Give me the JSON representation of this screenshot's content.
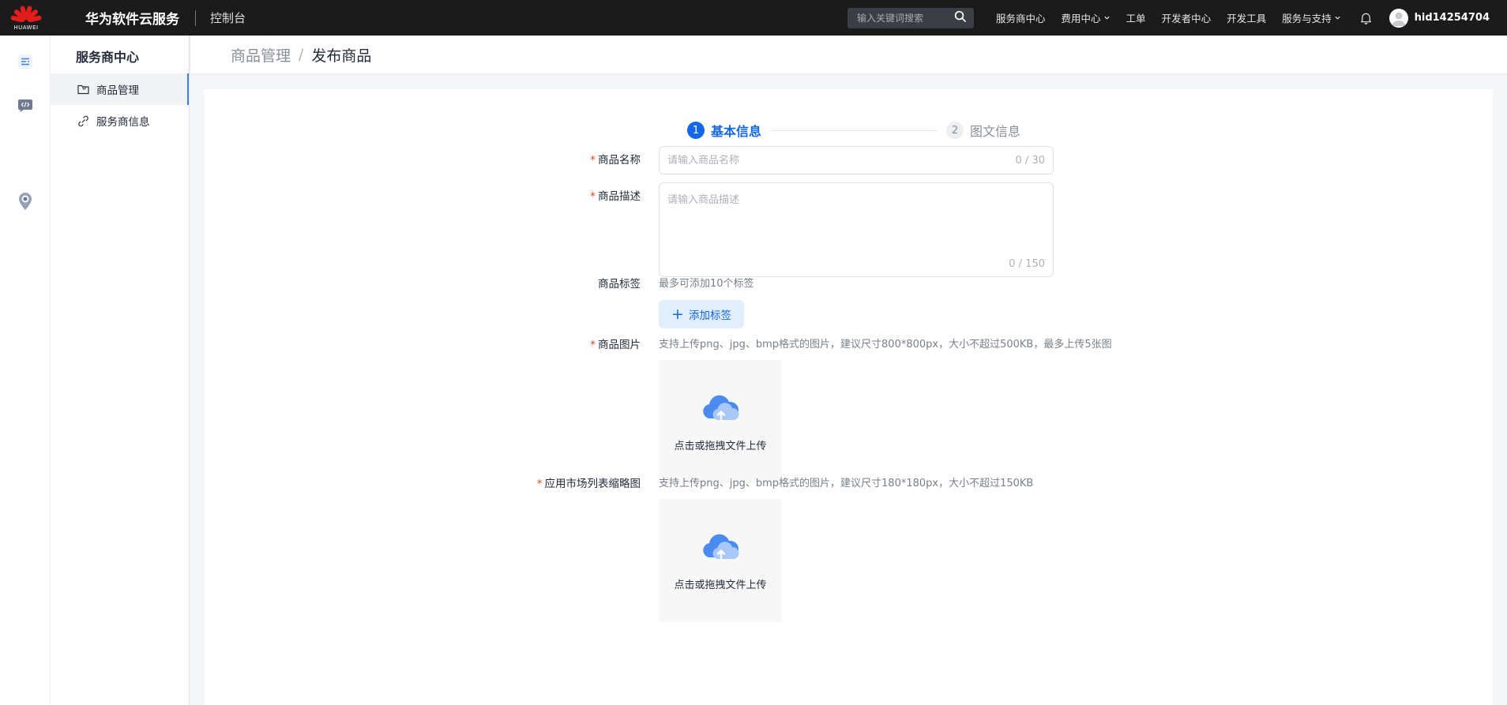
{
  "topbar": {
    "brand_text": "HUAWEI",
    "product_name": "华为软件云服务",
    "console": "控制台",
    "search_placeholder": "输入关键词搜索",
    "nav": [
      {
        "label": "服务商中心"
      },
      {
        "label": "费用中心"
      },
      {
        "label": "工单"
      },
      {
        "label": "开发者中心"
      },
      {
        "label": "开发工具"
      },
      {
        "label": "服务与支持"
      }
    ],
    "username": "hid14254704",
    "colors": {
      "bg": "#1b1b1b",
      "logo_red": "#e31d1c"
    }
  },
  "rail": {
    "items": [
      {
        "icon": "list-icon"
      },
      {
        "icon": "code-icon"
      },
      {
        "icon": "location-pin-icon"
      }
    ]
  },
  "sidebar": {
    "title": "服务商中心",
    "items": [
      {
        "label": "商品管理",
        "icon": "folder-icon",
        "active": true
      },
      {
        "label": "服务商信息",
        "icon": "link-icon",
        "active": false
      }
    ]
  },
  "breadcrumb": {
    "parent": "商品管理",
    "separator": "/",
    "current": "发布商品"
  },
  "steps": [
    {
      "num": "1",
      "label": "基本信息",
      "active": true
    },
    {
      "num": "2",
      "label": "图文信息",
      "active": false
    }
  ],
  "form": {
    "name": {
      "label": "商品名称",
      "required": true,
      "placeholder": "请输入商品名称",
      "counter": "0 / 30"
    },
    "description": {
      "label": "商品描述",
      "required": true,
      "placeholder": "请输入商品描述",
      "counter": "0 / 150"
    },
    "tags": {
      "label": "商品标签",
      "hint": "最多可添加10个标签",
      "add_label": "添加标签"
    },
    "images": {
      "label": "商品图片",
      "required": true,
      "hint": "支持上传png、jpg、bmp格式的图片，建议尺寸800*800px，大小不超过500KB，最多上传5张图",
      "upload_text": "点击或拖拽文件上传"
    },
    "thumbnail": {
      "label": "应用市场列表缩略图",
      "required": true,
      "hint": "支持上传png、jpg、bmp格式的图片，建议尺寸180*180px，大小不超过150KB",
      "upload_text": "点击或拖拽文件上传"
    }
  },
  "colors": {
    "primary": "#1368e5",
    "required": "#e5451b",
    "tag_bg": "#e3eefd"
  }
}
